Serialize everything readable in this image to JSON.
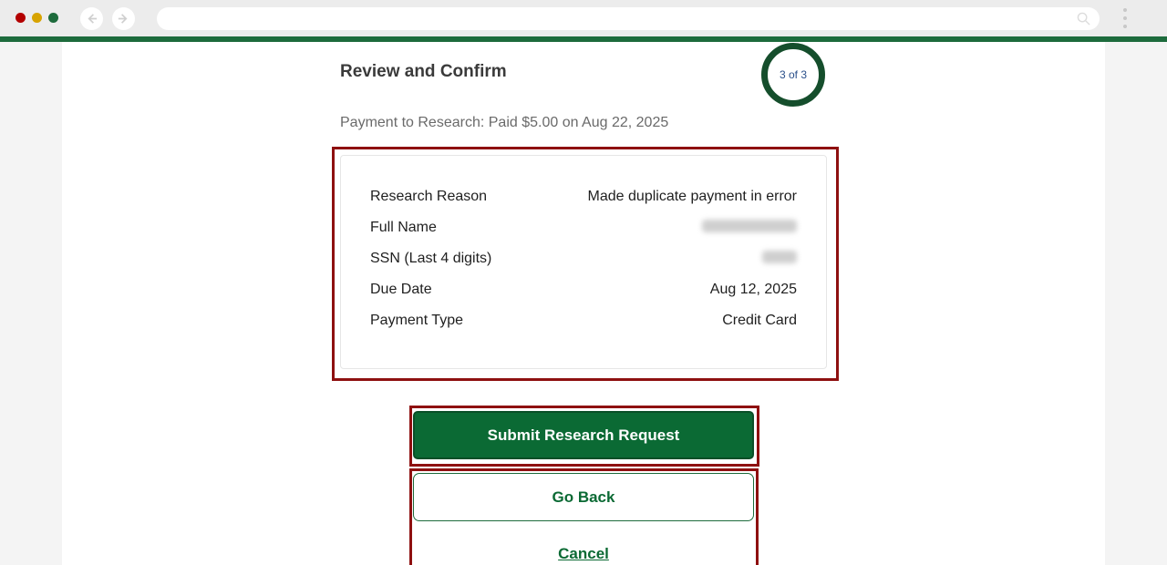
{
  "page": {
    "title": "Review and Confirm",
    "step": "3 of 3",
    "payment_line": "Payment to Research: Paid $5.00 on Aug 22, 2025"
  },
  "details": [
    {
      "label": "Research Reason",
      "value": "Made duplicate payment in error"
    },
    {
      "label": "Full Name",
      "value": ""
    },
    {
      "label": "SSN (Last 4 digits)",
      "value": ""
    },
    {
      "label": "Due Date",
      "value": "Aug 12, 2025"
    },
    {
      "label": "Payment Type",
      "value": "Credit Card"
    }
  ],
  "actions": {
    "submit_label": "Submit Research Request",
    "back_label": "Go Back",
    "cancel_label": "Cancel"
  },
  "colors": {
    "brand_green": "#0b6a34",
    "ring_green": "#154e2c",
    "highlight_red": "#8e1010"
  },
  "icons": {
    "back": "arrow-left-icon",
    "forward": "arrow-right-icon",
    "search": "search-icon",
    "menu": "kebab-menu-icon"
  }
}
